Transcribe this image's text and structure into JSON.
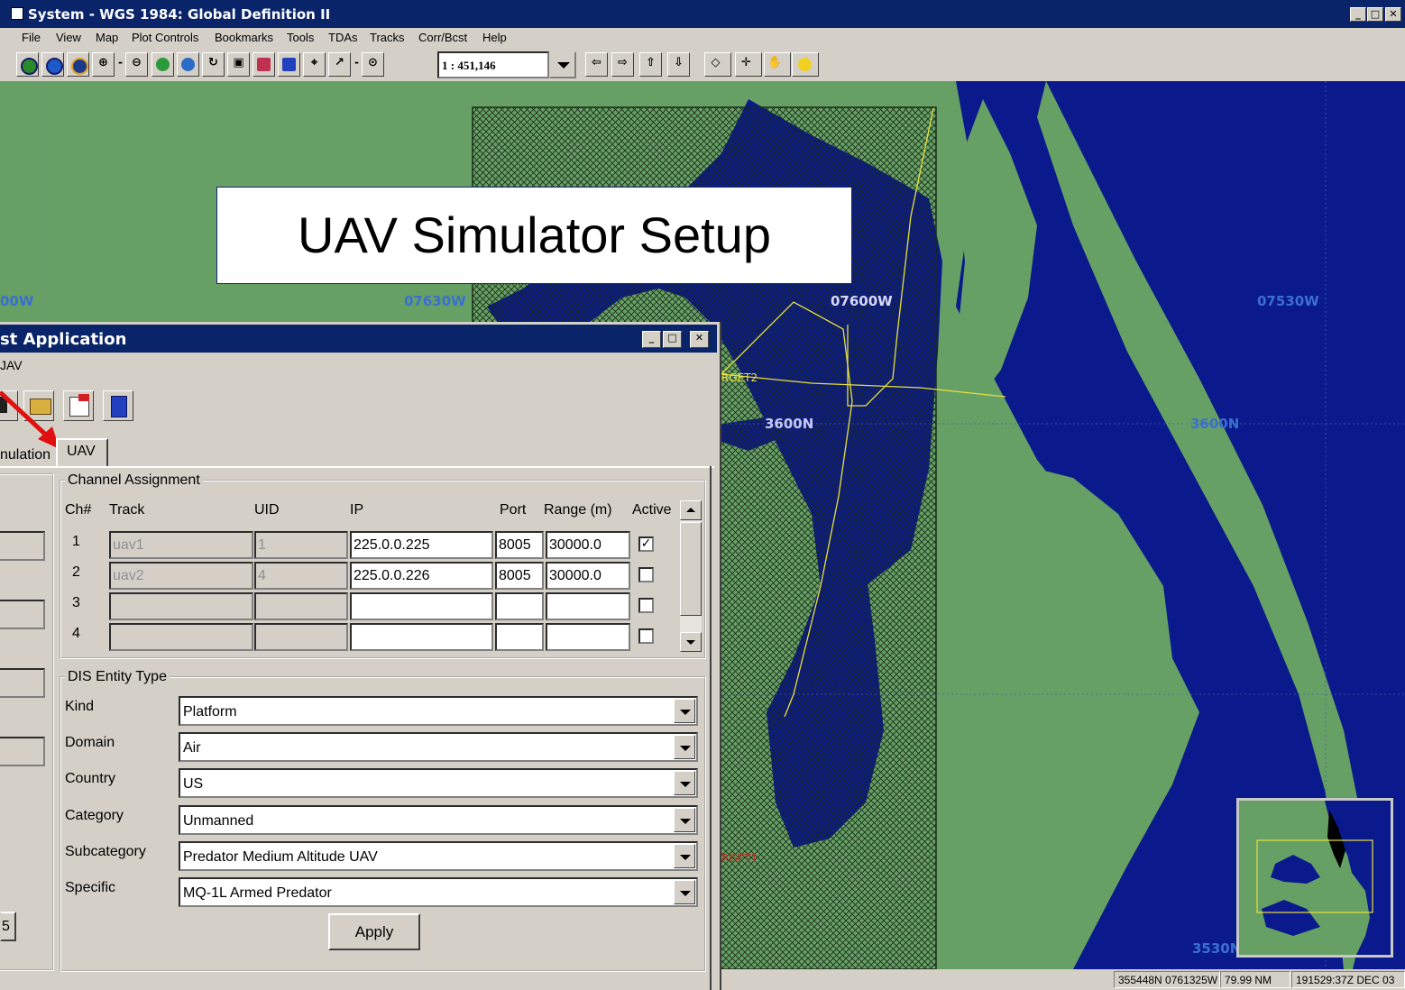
{
  "window": {
    "title": "System - WGS 1984: Global Definition II"
  },
  "menu": [
    "File",
    "View",
    "Map",
    "Plot Controls",
    "Bookmarks",
    "Tools",
    "TDAs",
    "Tracks",
    "Corr/Bcst",
    "Help"
  ],
  "toolbar": {
    "scale": "1 : 451,146"
  },
  "map": {
    "grid_labels": [
      "00W",
      "07630W",
      "07600W",
      "07530W",
      "3600N",
      "3600N",
      "3530N"
    ],
    "track_labels": [
      "RGET2",
      "RGET1"
    ],
    "colors": {
      "land": "#66a064",
      "water": "#0a1a8c",
      "tracks": "#e8e040"
    }
  },
  "slide_title": "UAV Simulator Setup",
  "status_bar": {
    "position": "355448N 0761325W",
    "range": "79.99 NM",
    "time": "191529:37Z DEC 03"
  },
  "dialog": {
    "title": "st Application",
    "menu_item": "JAV",
    "tabs": {
      "simulation": "nulation",
      "uav": "UAV"
    },
    "channel_group": {
      "legend": "Channel Assignment",
      "headers": [
        "Ch#",
        "Track",
        "UID",
        "IP",
        "Port",
        "Range (m)",
        "Active"
      ],
      "rows": [
        {
          "ch": "1",
          "track": "uav1",
          "uid": "1",
          "ip": "225.0.0.225",
          "port": "8005",
          "range": "30000.0",
          "active": true
        },
        {
          "ch": "2",
          "track": "uav2",
          "uid": "4",
          "ip": "225.0.0.226",
          "port": "8005",
          "range": "30000.0",
          "active": false
        },
        {
          "ch": "3",
          "track": "",
          "uid": "",
          "ip": "",
          "port": "",
          "range": "",
          "active": false
        },
        {
          "ch": "4",
          "track": "",
          "uid": "",
          "ip": "",
          "port": "",
          "range": "",
          "active": false
        }
      ]
    },
    "dis_group": {
      "legend": "DIS Entity Type",
      "fields": [
        {
          "label": "Kind",
          "value": "Platform"
        },
        {
          "label": "Domain",
          "value": "Air"
        },
        {
          "label": "Country",
          "value": "US"
        },
        {
          "label": "Category",
          "value": "Unmanned"
        },
        {
          "label": "Subcategory",
          "value": "Predator Medium Altitude UAV"
        },
        {
          "label": "Specific",
          "value": "MQ-1L Armed Predator"
        }
      ]
    },
    "apply_label": "Apply",
    "left_button_label": "5"
  }
}
